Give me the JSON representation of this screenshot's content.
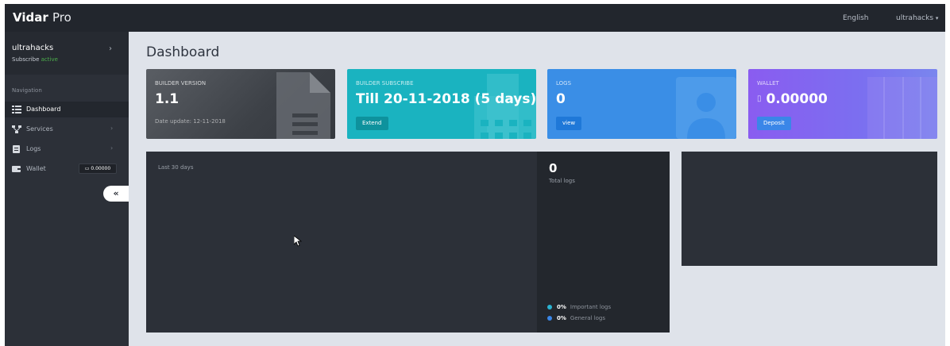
{
  "topbar": {
    "brand_main": "Vidar",
    "brand_sub": "Pro",
    "language": "English",
    "user": "ultrahacks",
    "user_caret": "▾"
  },
  "sidebar": {
    "username": "ultrahacks",
    "subscribe_label": "Subscribe",
    "subscribe_status": "active",
    "profile_chevron": "›",
    "nav_heading": "Navigation",
    "items": [
      {
        "label": "Dashboard",
        "icon": "dashboard-icon"
      },
      {
        "label": "Services",
        "icon": "services-icon",
        "chevron": "›"
      },
      {
        "label": "Logs",
        "icon": "logs-icon",
        "chevron": "›"
      },
      {
        "label": "Wallet",
        "icon": "wallet-icon",
        "badge": "0.00000"
      }
    ],
    "collapse_label": "«"
  },
  "main": {
    "title": "Dashboard",
    "cards": {
      "builder": {
        "label": "Builder version",
        "value": "1.1",
        "sub": "Date update: 12-11-2018"
      },
      "subscribe": {
        "label": "Builder subscribe",
        "value": "Till 20-11-2018 (5 days)",
        "button": "Extend"
      },
      "logs": {
        "label": "Logs",
        "value": "0",
        "button": "view"
      },
      "wallet": {
        "label": "Wallet",
        "value": "0.00000",
        "button": "Deposit"
      }
    },
    "stats": {
      "range": "Last 30 days",
      "total_value": "0",
      "total_label": "Total logs",
      "legend": [
        {
          "pct": "0%",
          "label": "Important logs",
          "color": "#2bb3d1"
        },
        {
          "pct": "0%",
          "label": "General logs",
          "color": "#3a86e8"
        }
      ]
    }
  },
  "colors": {
    "topbar": "#22262d",
    "sidebar": "#2c3038",
    "content_bg": "#dfe3ea",
    "subscribe_card": "#1ab3c0",
    "logs_card": "#3a8ee6",
    "wallet_card": "#8a5cf0",
    "active_status": "#4cae4c"
  }
}
